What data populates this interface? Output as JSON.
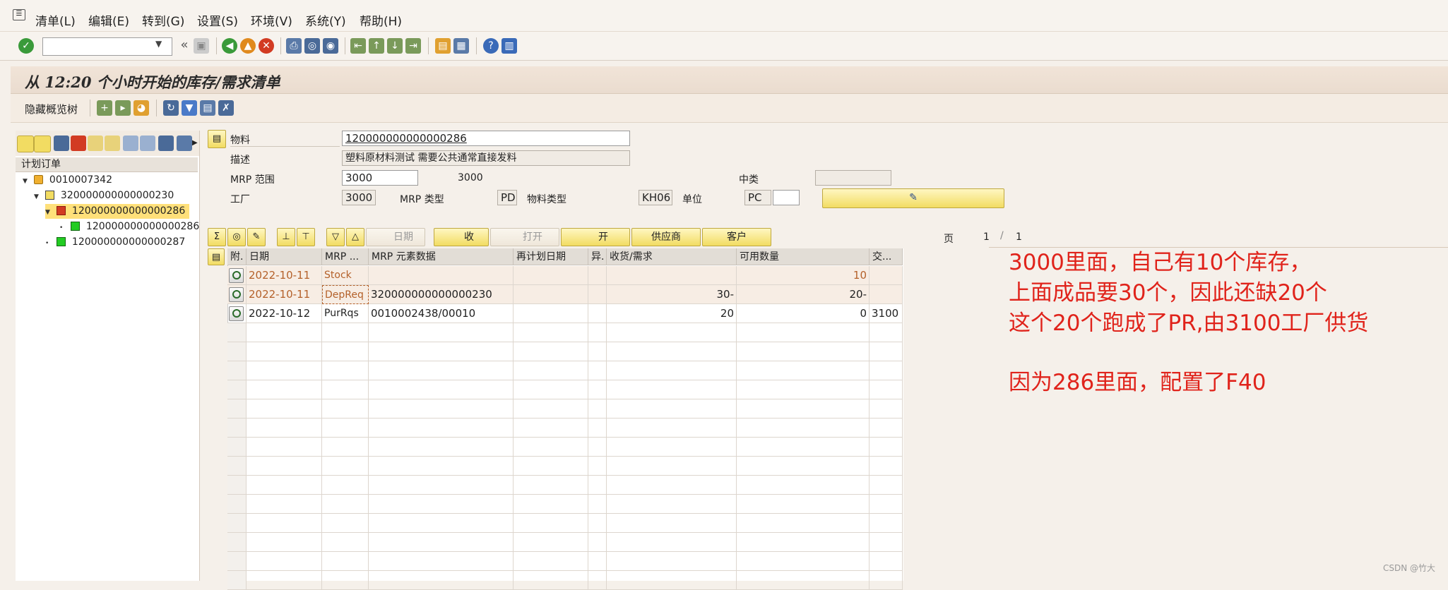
{
  "menu": [
    {
      "label": "清单(L)"
    },
    {
      "label": "编辑(E)"
    },
    {
      "label": "转到(G)"
    },
    {
      "label": "设置(S)"
    },
    {
      "label": "环境(V)"
    },
    {
      "label": "系统(Y)"
    },
    {
      "label": "帮助(H)"
    }
  ],
  "system_toolbar": {
    "command_field_value": "",
    "icons": [
      "enter-icon",
      "save-icon",
      "back-icon",
      "exit-icon",
      "cancel-icon",
      "print-icon",
      "find-icon",
      "find-next-icon",
      "first-page-icon",
      "prev-page-icon",
      "next-page-icon",
      "last-page-icon",
      "new-session-icon",
      "shortcut-icon",
      "help-icon",
      "layout-icon"
    ]
  },
  "title": "从 12:20 个小时开始的库存/需求清单",
  "app_toolbar": {
    "hide_tree_label": "隐藏概览树"
  },
  "tree": {
    "header": "计划订单",
    "nodes": [
      {
        "label": "0010007342",
        "level": 0,
        "expanded": true,
        "icon": "truck-icon"
      },
      {
        "label": "320000000000000230",
        "level": 1,
        "expanded": true,
        "icon": "warning-icon"
      },
      {
        "label": "120000000000000286",
        "level": 2,
        "expanded": true,
        "icon": "exception-icon",
        "selected": true
      },
      {
        "label": "120000000000000286",
        "level": 3,
        "expanded": false,
        "icon": "green-status-icon"
      },
      {
        "label": "120000000000000287",
        "level": 2,
        "expanded": false,
        "icon": "green-status-icon"
      }
    ]
  },
  "header": {
    "material_label": "物料",
    "material_value": "120000000000000286",
    "desc_label": "描述",
    "desc_value": "塑料原材料测试  需要公共通常直接发料",
    "mrp_area_label": "MRP 范围",
    "mrp_area_value": "3000",
    "mrp_area_text": "3000",
    "plant_label": "工厂",
    "plant_value": "3000",
    "mrp_type_label": "MRP 类型",
    "mrp_type_value": "PD",
    "mat_type_label": "物料类型",
    "mat_type_value": "KH06",
    "unit_label": "单位",
    "unit_value": "PC",
    "category_label": "中类",
    "category_value": ""
  },
  "grid_toolbar": {
    "date_label": "日期",
    "receipt_label": "收",
    "open_label": "打开",
    "open2_label": "开",
    "vendor_label": "供应商",
    "customer_label": "客户",
    "page_label": "页",
    "page_current": "1",
    "page_sep": "/",
    "page_total": "1"
  },
  "table": {
    "columns": [
      "附.",
      "日期",
      "MRP ...",
      "MRP 元素数据",
      "再计划日期",
      "异.",
      "收货/需求",
      "可用数量",
      "交..."
    ],
    "rows": [
      {
        "date": "2022-10-11",
        "mrp": "Stock",
        "data": "",
        "resched": "",
        "exc": "",
        "qty": "",
        "avail": "10",
        "supp": "",
        "highlight": true
      },
      {
        "date": "2022-10-11",
        "mrp": "DepReq",
        "data": "320000000000000230",
        "resched": "",
        "exc": "",
        "qty": "30-",
        "avail": "20-",
        "supp": "",
        "highlight": true
      },
      {
        "date": "2022-10-12",
        "mrp": "PurRqs",
        "data": "0010002438/00010",
        "resched": "",
        "exc": "",
        "qty": "20",
        "avail": "0",
        "supp": "3100",
        "highlight": false
      }
    ]
  },
  "annotation": {
    "line1": "3000里面，自己有10个库存，",
    "line2": "上面成品要30个，因此还缺20个",
    "line3": "这个20个跑成了PR,由3100工厂供货",
    "line4": "因为286里面，配置了F40"
  },
  "watermark": "CSDN @竹大",
  "colors": {
    "annotation": "#e0231b",
    "button_yellow": "#f2dc62",
    "accent_orange": "#b4612a",
    "ok_green": "#3a9a3a"
  }
}
